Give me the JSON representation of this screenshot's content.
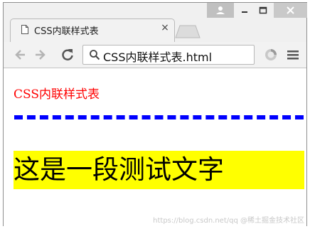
{
  "browser": {
    "tab": {
      "title": "CSS内联样式表",
      "close_glyph": "×",
      "doc_icon": "document-icon"
    },
    "window_controls": {
      "user_icon": "user-icon",
      "minimize_icon": "minimize-icon",
      "maximize_icon": "maximize-icon",
      "close_icon": "close-icon"
    },
    "toolbar": {
      "back_icon": "arrow-left-icon",
      "forward_icon": "arrow-right-icon",
      "reload_icon": "reload-icon",
      "address": "CSS内联样式表.html",
      "search_icon": "search-icon",
      "extension_icon": "extension-icon",
      "menu_icon": "menu-icon"
    }
  },
  "page": {
    "heading": "CSS内联样式表",
    "heading_color": "#ff0000",
    "dashed_line_color": "#0000ff",
    "highlight_text": "这是一段测试文字",
    "highlight_background": "#ffff00"
  },
  "watermark": "https://blog.csdn.net/qq @稀土掘金技术社区"
}
